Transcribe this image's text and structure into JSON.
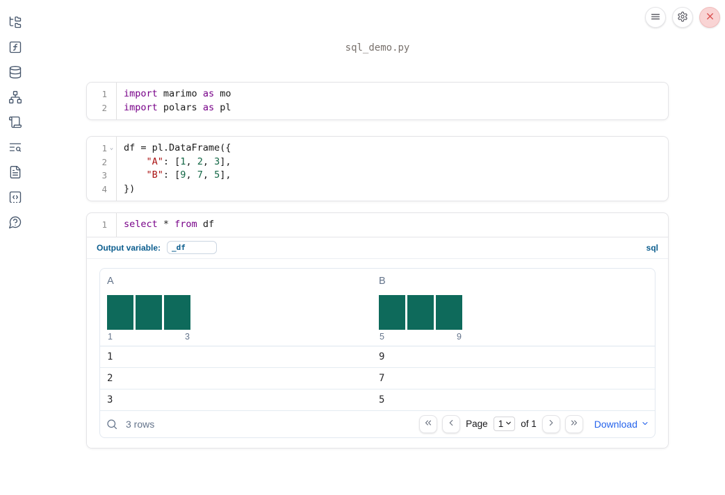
{
  "app": {
    "title": "sql_demo.py"
  },
  "topbar": {
    "buttons": [
      {
        "name": "menu-button",
        "icon": "hamburger-menu-icon"
      },
      {
        "name": "settings-button",
        "icon": "gear-icon"
      },
      {
        "name": "close-button",
        "icon": "close-icon"
      }
    ]
  },
  "sidebar": {
    "items": [
      {
        "name": "file-explorer",
        "icon": "folder-tree-icon"
      },
      {
        "name": "functions",
        "icon": "function-square-icon"
      },
      {
        "name": "data-sources",
        "icon": "database-icon"
      },
      {
        "name": "dependency-graph",
        "icon": "network-icon"
      },
      {
        "name": "logs",
        "icon": "scroll-icon"
      },
      {
        "name": "scratchpad-search",
        "icon": "list-search-icon"
      },
      {
        "name": "documentation",
        "icon": "file-text-icon"
      },
      {
        "name": "snippets",
        "icon": "code-square-icon"
      },
      {
        "name": "help",
        "icon": "help-bubble-icon"
      }
    ]
  },
  "colors": {
    "accent_blue": "#0b5d8e",
    "link_blue": "#2563eb",
    "histogram_teal": "#0e6a5b",
    "keyword": "#770088",
    "string": "#aa1111",
    "number": "#116644",
    "close_red": "#d94f4f"
  },
  "cells": [
    {
      "id": "imports",
      "lines": [
        {
          "num": "1",
          "fold": false,
          "tokens": [
            [
              "kw",
              "import"
            ],
            [
              "pl",
              " marimo "
            ],
            [
              "kw",
              "as"
            ],
            [
              "pl",
              " mo"
            ]
          ]
        },
        {
          "num": "2",
          "fold": false,
          "tokens": [
            [
              "kw",
              "import"
            ],
            [
              "pl",
              " polars "
            ],
            [
              "kw",
              "as"
            ],
            [
              "pl",
              " pl"
            ]
          ]
        }
      ]
    },
    {
      "id": "dataframe",
      "lines": [
        {
          "num": "1",
          "fold": true,
          "tokens": [
            [
              "pl",
              "df = pl.DataFrame({"
            ]
          ]
        },
        {
          "num": "2",
          "fold": false,
          "tokens": [
            [
              "pl",
              "    "
            ],
            [
              "str",
              "\"A\""
            ],
            [
              "pl",
              ": ["
            ],
            [
              "num",
              "1"
            ],
            [
              "pl",
              ", "
            ],
            [
              "num",
              "2"
            ],
            [
              "pl",
              ", "
            ],
            [
              "num",
              "3"
            ],
            [
              "pl",
              "],"
            ]
          ]
        },
        {
          "num": "3",
          "fold": false,
          "tokens": [
            [
              "pl",
              "    "
            ],
            [
              "str",
              "\"B\""
            ],
            [
              "pl",
              ": ["
            ],
            [
              "num",
              "9"
            ],
            [
              "pl",
              ", "
            ],
            [
              "num",
              "7"
            ],
            [
              "pl",
              ", "
            ],
            [
              "num",
              "5"
            ],
            [
              "pl",
              "],"
            ]
          ]
        },
        {
          "num": "4",
          "fold": false,
          "tokens": [
            [
              "pl",
              "})"
            ]
          ]
        }
      ]
    },
    {
      "id": "sql",
      "lines": [
        {
          "num": "1",
          "fold": false,
          "tokens": [
            [
              "kw",
              "select"
            ],
            [
              "pl",
              " * "
            ],
            [
              "kw",
              "from"
            ],
            [
              "pl",
              " df"
            ]
          ]
        }
      ]
    }
  ],
  "sql_cell": {
    "output_variable_label": "Output variable:",
    "output_variable_value": "_df",
    "language_label": "sql"
  },
  "table": {
    "columns": [
      {
        "name": "A",
        "histogram_bars": [
          1,
          1,
          1
        ],
        "axis_min": "1",
        "axis_max": "3"
      },
      {
        "name": "B",
        "histogram_bars": [
          1,
          1,
          1
        ],
        "axis_min": "5",
        "axis_max": "9"
      }
    ],
    "rows": [
      [
        "1",
        "9"
      ],
      [
        "2",
        "7"
      ],
      [
        "3",
        "5"
      ]
    ],
    "footer": {
      "row_count": "3 rows",
      "page_label": "Page",
      "page_value": "1",
      "of_label": "of 1",
      "download_label": "Download"
    }
  }
}
